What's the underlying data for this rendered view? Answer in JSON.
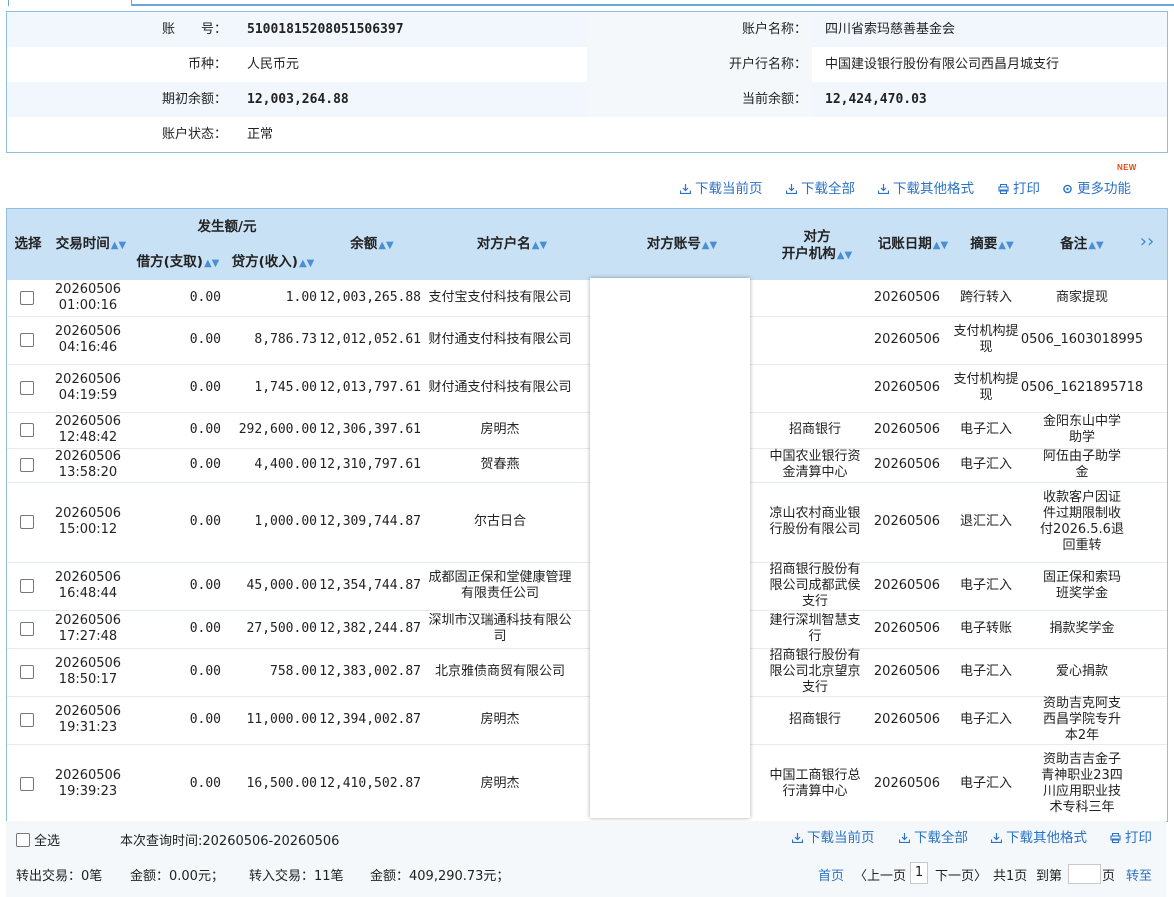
{
  "account": {
    "account_no_label": "账　　号：",
    "account_no": "51001815208051506397",
    "account_name_label": "账户名称：",
    "account_name": "四川省索玛慈善基金会",
    "currency_label": "币种：",
    "currency": "人民币元",
    "bank_label": "开户行名称：",
    "bank": "中国建设银行股份有限公司西昌月城支行",
    "opening_balance_label": "期初余额：",
    "opening_balance": "12,003,264.88",
    "current_balance_label": "当前余额：",
    "current_balance": "12,424,470.03",
    "status_label": "账户状态：",
    "status": "正常"
  },
  "toolbar": {
    "download_page": "下载当前页",
    "download_all": "下载全部",
    "download_other": "下载其他格式",
    "print": "打印",
    "more": "更多功能",
    "new_badge": "NEW"
  },
  "table": {
    "headers": {
      "select": "选择",
      "time": "交易时间",
      "amount_group": "发生额/元",
      "debit": "借方(支取)",
      "credit": "贷方(收入)",
      "balance": "余额",
      "counter_name": "对方户名",
      "counter_account": "对方账号",
      "counter_bank_1": "对方",
      "counter_bank_2": "开户机构",
      "post_date": "记账日期",
      "summary": "摘要",
      "remark": "备注",
      "more_cols": "››"
    },
    "rows": [
      {
        "date": "20260506",
        "time": "01:00:16",
        "debit": "0.00",
        "credit": "1.00",
        "balance": "12,003,265.88",
        "name": "支付宝支付科技有限公司",
        "bank": "",
        "post": "20260506",
        "summary": "跨行转入",
        "remark": "商家提现"
      },
      {
        "date": "20260506",
        "time": "04:16:46",
        "debit": "0.00",
        "credit": "8,786.73",
        "balance": "12,012,052.61",
        "name": "财付通支付科技有限公司",
        "bank": "",
        "post": "20260506",
        "summary": "支付机构提现",
        "remark": "0506_1603018995"
      },
      {
        "date": "20260506",
        "time": "04:19:59",
        "debit": "0.00",
        "credit": "1,745.00",
        "balance": "12,013,797.61",
        "name": "财付通支付科技有限公司",
        "bank": "",
        "post": "20260506",
        "summary": "支付机构提现",
        "remark": "0506_1621895718"
      },
      {
        "date": "20260506",
        "time": "12:48:42",
        "debit": "0.00",
        "credit": "292,600.00",
        "balance": "12,306,397.61",
        "name": "房明杰",
        "bank": "招商银行",
        "post": "20260506",
        "summary": "电子汇入",
        "remark": "金阳东山中学助学"
      },
      {
        "date": "20260506",
        "time": "13:58:20",
        "debit": "0.00",
        "credit": "4,400.00",
        "balance": "12,310,797.61",
        "name": "贺春燕",
        "bank": "中国农业银行资金清算中心",
        "post": "20260506",
        "summary": "电子汇入",
        "remark": "阿伍由子助学金"
      },
      {
        "date": "20260506",
        "time": "15:00:12",
        "debit": "0.00",
        "credit": "1,000.00",
        "balance": "12,309,744.87",
        "name": "尔古日合",
        "bank": "凉山农村商业银行股份有限公司",
        "post": "20260506",
        "summary": "退汇汇入",
        "remark": "收款客户因证件过期限制收付2026.5.6退回重转"
      },
      {
        "date": "20260506",
        "time": "16:48:44",
        "debit": "0.00",
        "credit": "45,000.00",
        "balance": "12,354,744.87",
        "name": "成都固正保和堂健康管理有限责任公司",
        "bank": "招商银行股份有限公司成都武侯支行",
        "post": "20260506",
        "summary": "电子汇入",
        "remark": "固正保和索玛班奖学金"
      },
      {
        "date": "20260506",
        "time": "17:27:48",
        "debit": "0.00",
        "credit": "27,500.00",
        "balance": "12,382,244.87",
        "name": "深圳市汉瑞通科技有限公司",
        "bank": "建行深圳智慧支行",
        "post": "20260506",
        "summary": "电子转账",
        "remark": "捐款奖学金"
      },
      {
        "date": "20260506",
        "time": "18:50:17",
        "debit": "0.00",
        "credit": "758.00",
        "balance": "12,383,002.87",
        "name": "北京雅债商贸有限公司",
        "bank": "招商银行股份有限公司北京望京支行",
        "post": "20260506",
        "summary": "电子汇入",
        "remark": "爱心捐款"
      },
      {
        "date": "20260506",
        "time": "19:31:23",
        "debit": "0.00",
        "credit": "11,000.00",
        "balance": "12,394,002.87",
        "name": "房明杰",
        "bank": "招商银行",
        "post": "20260506",
        "summary": "电子汇入",
        "remark": "资助吉克阿支西昌学院专升本2年"
      },
      {
        "date": "20260506",
        "time": "19:39:23",
        "debit": "0.00",
        "credit": "16,500.00",
        "balance": "12,410,502.87",
        "name": "房明杰",
        "bank": "中国工商银行总行清算中心",
        "post": "20260506",
        "summary": "电子汇入",
        "remark": "资助吉吉金子青神职业23四川应用职业技术专科三年"
      }
    ]
  },
  "footer": {
    "select_all": "全选",
    "query_time": "本次查询时间:20260506-20260506",
    "download_page": "下载当前页",
    "download_all": "下载全部",
    "download_other": "下载其他格式",
    "print": "打印",
    "out_count": "转出交易：0笔",
    "out_amount": "金额：0.00元；",
    "in_count": "转入交易：11笔",
    "in_amount": "金额：409,290.73元；",
    "first": "首页",
    "prev": "〈上一页",
    "page_no": "1",
    "next": "下一页〉",
    "total": "共1页",
    "goto": "到第",
    "page_unit": "页",
    "go": "转至"
  },
  "colors": {
    "accent": "#2c73c5",
    "header_bg": "#c9e1f4",
    "border": "#8fbde3"
  }
}
